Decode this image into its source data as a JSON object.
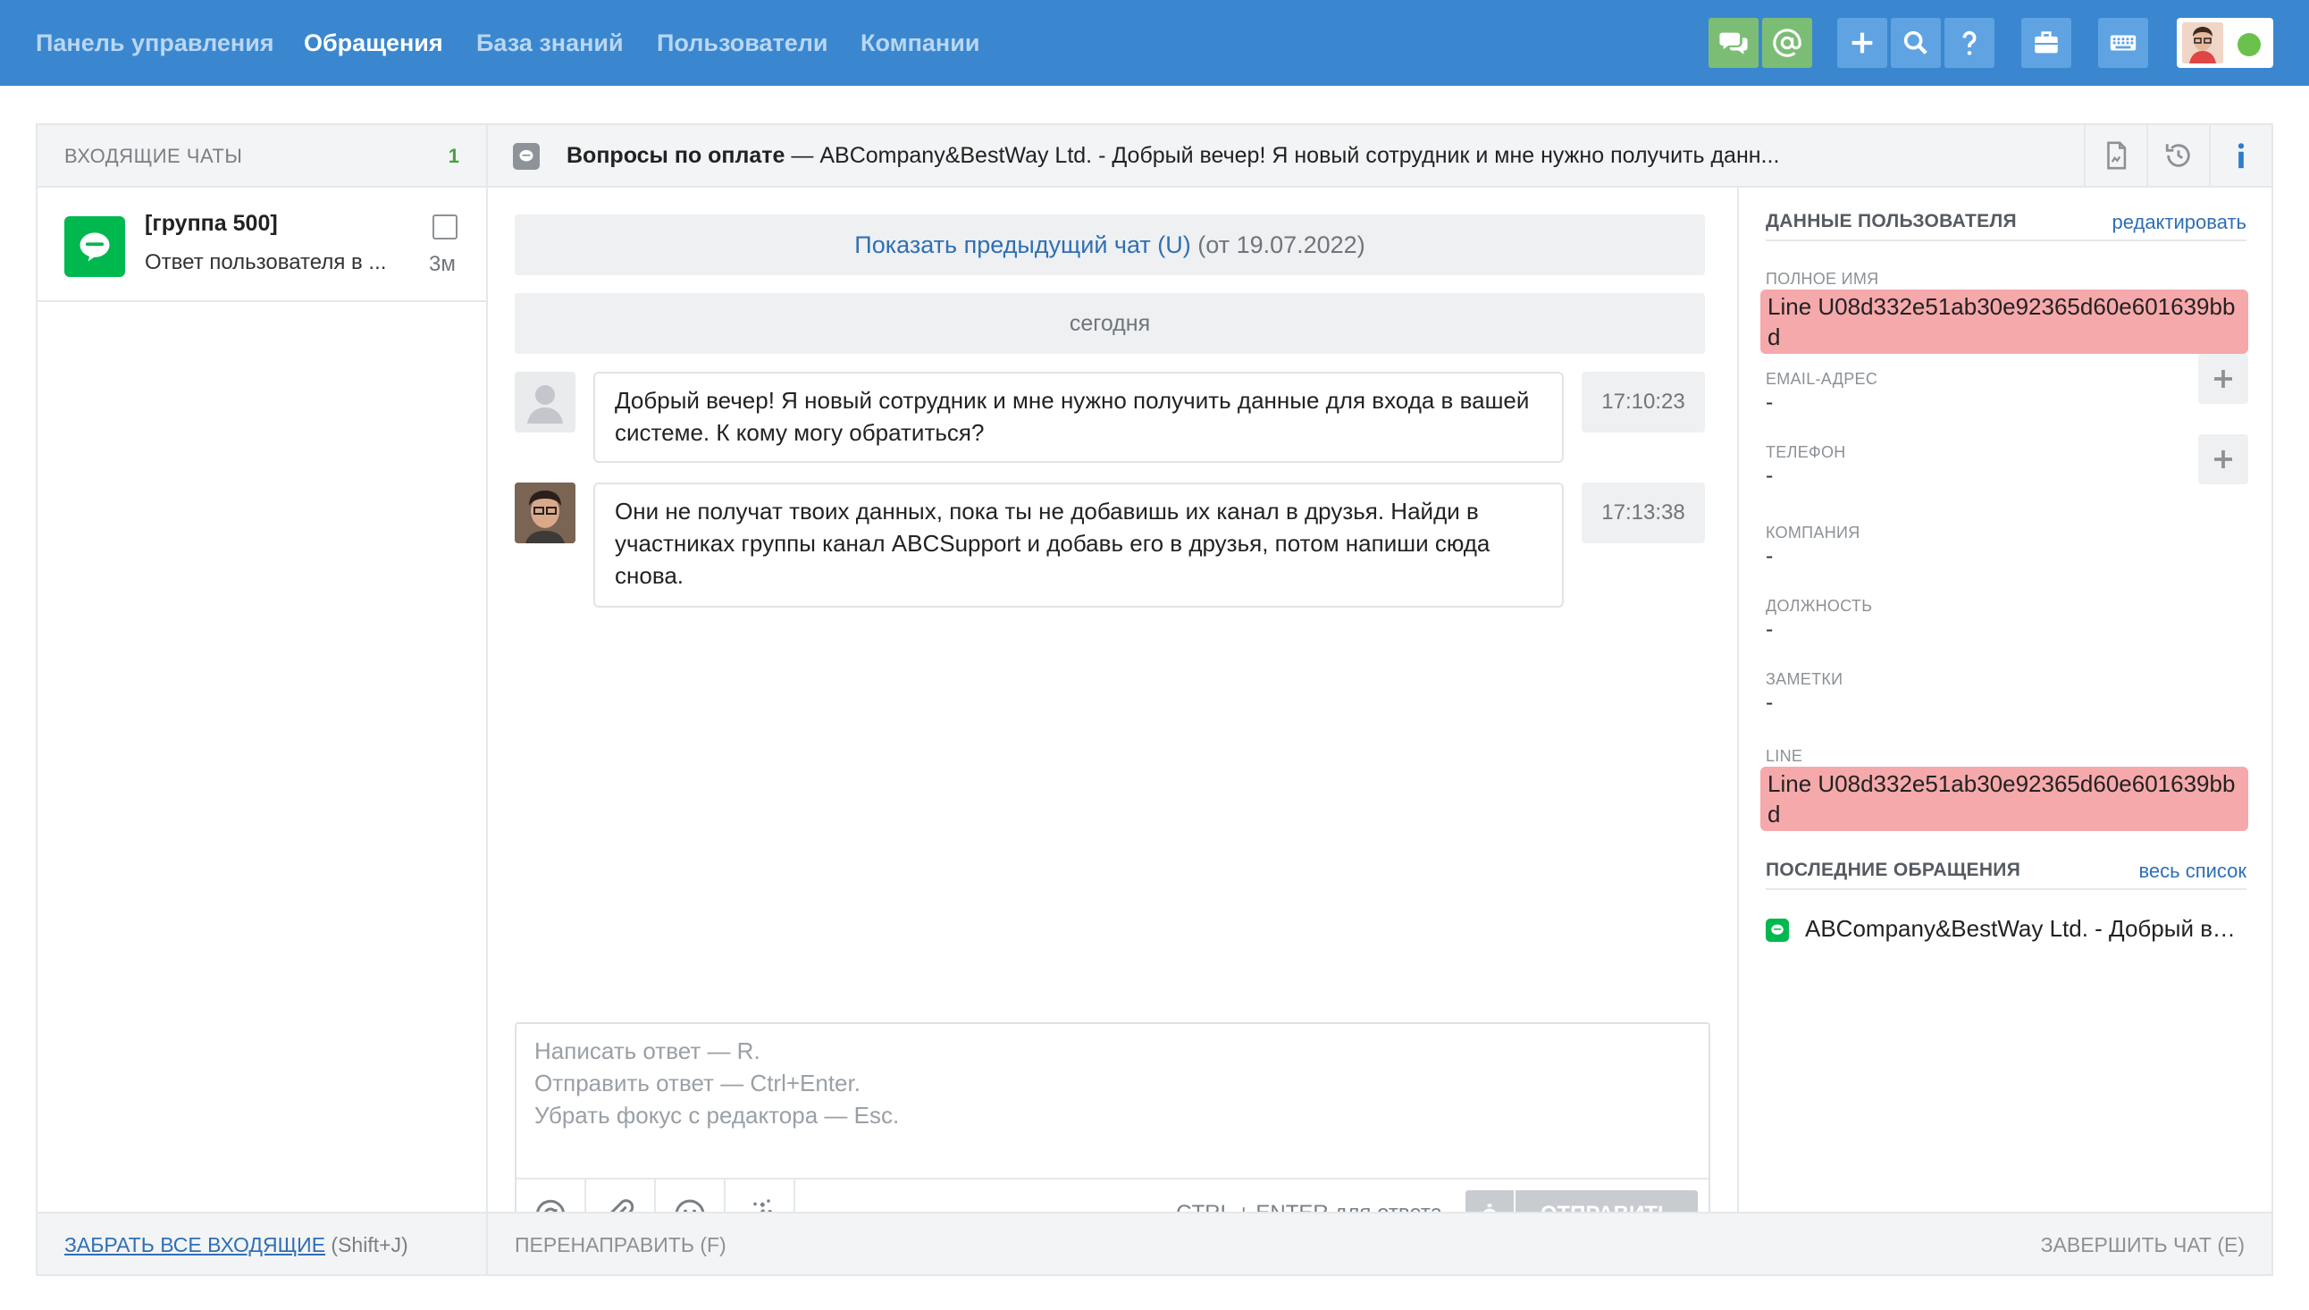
{
  "nav": {
    "items": [
      {
        "label": "Панель управления",
        "active": false
      },
      {
        "label": "Обращения",
        "active": true
      },
      {
        "label": "База знаний",
        "active": false
      },
      {
        "label": "Пользователи",
        "active": false
      },
      {
        "label": "Компании",
        "active": false
      }
    ],
    "buttons": [
      "chat-bubbles-icon",
      "at-sign-icon",
      "plus-icon",
      "search-icon",
      "help-icon",
      "briefcase-icon",
      "keyboard-icon"
    ],
    "status_color": "#6ac24c"
  },
  "incoming": {
    "title": "ВХОДЯЩИЕ ЧАТЫ",
    "count": "1",
    "chats": [
      {
        "group": "[группа 500]",
        "preview": "Ответ пользователя в ...",
        "time": "3м"
      }
    ],
    "take_all_label": "ЗАБРАТЬ ВСЕ ВХОДЯЩИЕ",
    "take_all_hotkey": " (Shift+J)"
  },
  "conversation": {
    "subject_bold": "Вопросы по оплате",
    "subject_rest": " — ABCompany&BestWay Ltd. - Добрый вечер! Я новый сотрудник и мне нужно получить данн...",
    "prev_chat_link": "Показать предыдущий чат (U)",
    "prev_chat_date": " (от 19.07.2022)",
    "day_label": "сегодня",
    "messages": [
      {
        "author": "client",
        "text": "Добрый вечер! Я новый сотрудник и мне нужно получить данные для входа в вашей системе. К кому могу обратиться?",
        "time": "17:10:23"
      },
      {
        "author": "agent",
        "text": "Они не получат твоих данных, пока ты не добавишь их канал в друзья. Найди в участниках группы канал ABCSupport и добавь его в друзья, потом напиши сюда снова.",
        "time": "17:13:38"
      }
    ],
    "composer": {
      "placeholder_lines": [
        "Написать ответ — R.",
        "Отправить ответ — Ctrl+Enter.",
        "Убрать фокус с редактора — Esc."
      ],
      "hint": "CTRL + ENTER для ответа",
      "send_label": "ОТПРАВИТЬ"
    },
    "forward_label": "ПЕРЕНАПРАВИТЬ (F)",
    "end_label": "ЗАВЕРШИТЬ ЧАТ (E)"
  },
  "user_info": {
    "section_title": "ДАННЫЕ ПОЛЬЗОВАТЕЛЯ",
    "edit_label": "редактировать",
    "fields": {
      "full_name_label": "ПОЛНОЕ ИМЯ",
      "full_name": "Line U08d332e51ab30e92365d60e601639bbd",
      "email_label": "EMAIL-АДРЕС",
      "email": "-",
      "phone_label": "ТЕЛЕФОН",
      "phone": "-",
      "company_label": "КОМПАНИЯ",
      "company": "-",
      "position_label": "ДОЛЖНОСТЬ",
      "position": "-",
      "notes_label": "ЗАМЕТКИ",
      "notes": "-",
      "line_label": "LINE",
      "line": "Line U08d332e51ab30e92365d60e601639bbd"
    },
    "recent_title": "ПОСЛЕДНИЕ ОБРАЩЕНИЯ",
    "recent_all_label": "весь список",
    "recent_items": [
      "ABCompany&BestWay Ltd. - Добрый вечер! Я новый сотрудник"
    ],
    "highlight_color": "#f5a9ab"
  }
}
